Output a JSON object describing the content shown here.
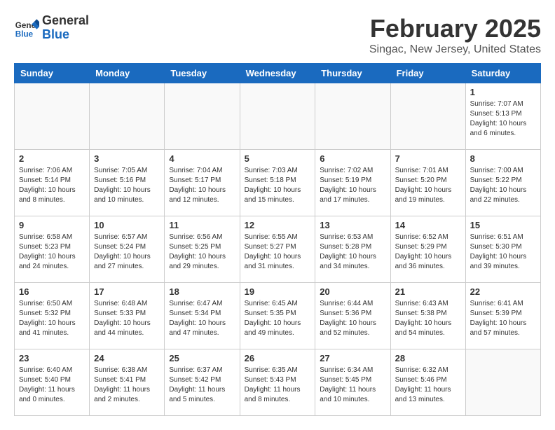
{
  "header": {
    "logo_line1": "General",
    "logo_line2": "Blue",
    "month": "February 2025",
    "location": "Singac, New Jersey, United States"
  },
  "weekdays": [
    "Sunday",
    "Monday",
    "Tuesday",
    "Wednesday",
    "Thursday",
    "Friday",
    "Saturday"
  ],
  "weeks": [
    [
      {
        "day": "",
        "info": ""
      },
      {
        "day": "",
        "info": ""
      },
      {
        "day": "",
        "info": ""
      },
      {
        "day": "",
        "info": ""
      },
      {
        "day": "",
        "info": ""
      },
      {
        "day": "",
        "info": ""
      },
      {
        "day": "1",
        "info": "Sunrise: 7:07 AM\nSunset: 5:13 PM\nDaylight: 10 hours\nand 6 minutes."
      }
    ],
    [
      {
        "day": "2",
        "info": "Sunrise: 7:06 AM\nSunset: 5:14 PM\nDaylight: 10 hours\nand 8 minutes."
      },
      {
        "day": "3",
        "info": "Sunrise: 7:05 AM\nSunset: 5:16 PM\nDaylight: 10 hours\nand 10 minutes."
      },
      {
        "day": "4",
        "info": "Sunrise: 7:04 AM\nSunset: 5:17 PM\nDaylight: 10 hours\nand 12 minutes."
      },
      {
        "day": "5",
        "info": "Sunrise: 7:03 AM\nSunset: 5:18 PM\nDaylight: 10 hours\nand 15 minutes."
      },
      {
        "day": "6",
        "info": "Sunrise: 7:02 AM\nSunset: 5:19 PM\nDaylight: 10 hours\nand 17 minutes."
      },
      {
        "day": "7",
        "info": "Sunrise: 7:01 AM\nSunset: 5:20 PM\nDaylight: 10 hours\nand 19 minutes."
      },
      {
        "day": "8",
        "info": "Sunrise: 7:00 AM\nSunset: 5:22 PM\nDaylight: 10 hours\nand 22 minutes."
      }
    ],
    [
      {
        "day": "9",
        "info": "Sunrise: 6:58 AM\nSunset: 5:23 PM\nDaylight: 10 hours\nand 24 minutes."
      },
      {
        "day": "10",
        "info": "Sunrise: 6:57 AM\nSunset: 5:24 PM\nDaylight: 10 hours\nand 27 minutes."
      },
      {
        "day": "11",
        "info": "Sunrise: 6:56 AM\nSunset: 5:25 PM\nDaylight: 10 hours\nand 29 minutes."
      },
      {
        "day": "12",
        "info": "Sunrise: 6:55 AM\nSunset: 5:27 PM\nDaylight: 10 hours\nand 31 minutes."
      },
      {
        "day": "13",
        "info": "Sunrise: 6:53 AM\nSunset: 5:28 PM\nDaylight: 10 hours\nand 34 minutes."
      },
      {
        "day": "14",
        "info": "Sunrise: 6:52 AM\nSunset: 5:29 PM\nDaylight: 10 hours\nand 36 minutes."
      },
      {
        "day": "15",
        "info": "Sunrise: 6:51 AM\nSunset: 5:30 PM\nDaylight: 10 hours\nand 39 minutes."
      }
    ],
    [
      {
        "day": "16",
        "info": "Sunrise: 6:50 AM\nSunset: 5:32 PM\nDaylight: 10 hours\nand 41 minutes."
      },
      {
        "day": "17",
        "info": "Sunrise: 6:48 AM\nSunset: 5:33 PM\nDaylight: 10 hours\nand 44 minutes."
      },
      {
        "day": "18",
        "info": "Sunrise: 6:47 AM\nSunset: 5:34 PM\nDaylight: 10 hours\nand 47 minutes."
      },
      {
        "day": "19",
        "info": "Sunrise: 6:45 AM\nSunset: 5:35 PM\nDaylight: 10 hours\nand 49 minutes."
      },
      {
        "day": "20",
        "info": "Sunrise: 6:44 AM\nSunset: 5:36 PM\nDaylight: 10 hours\nand 52 minutes."
      },
      {
        "day": "21",
        "info": "Sunrise: 6:43 AM\nSunset: 5:38 PM\nDaylight: 10 hours\nand 54 minutes."
      },
      {
        "day": "22",
        "info": "Sunrise: 6:41 AM\nSunset: 5:39 PM\nDaylight: 10 hours\nand 57 minutes."
      }
    ],
    [
      {
        "day": "23",
        "info": "Sunrise: 6:40 AM\nSunset: 5:40 PM\nDaylight: 11 hours\nand 0 minutes."
      },
      {
        "day": "24",
        "info": "Sunrise: 6:38 AM\nSunset: 5:41 PM\nDaylight: 11 hours\nand 2 minutes."
      },
      {
        "day": "25",
        "info": "Sunrise: 6:37 AM\nSunset: 5:42 PM\nDaylight: 11 hours\nand 5 minutes."
      },
      {
        "day": "26",
        "info": "Sunrise: 6:35 AM\nSunset: 5:43 PM\nDaylight: 11 hours\nand 8 minutes."
      },
      {
        "day": "27",
        "info": "Sunrise: 6:34 AM\nSunset: 5:45 PM\nDaylight: 11 hours\nand 10 minutes."
      },
      {
        "day": "28",
        "info": "Sunrise: 6:32 AM\nSunset: 5:46 PM\nDaylight: 11 hours\nand 13 minutes."
      },
      {
        "day": "",
        "info": ""
      }
    ]
  ]
}
